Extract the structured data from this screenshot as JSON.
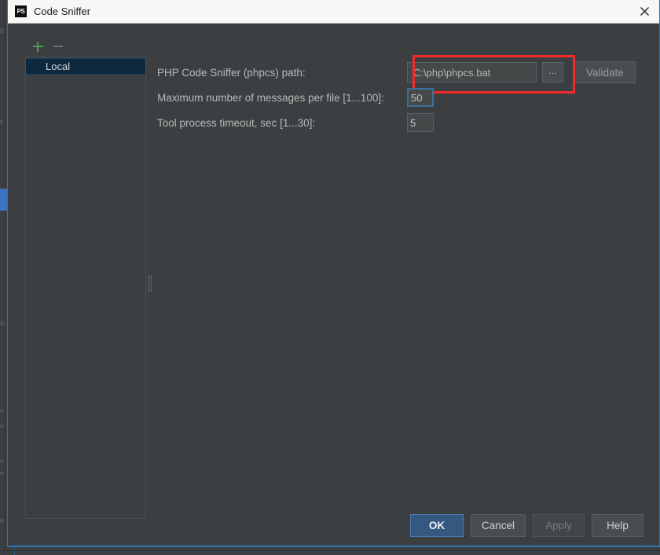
{
  "window": {
    "title": "Code Sniffer",
    "app_icon": "phpstorm-ps-icon",
    "icon_label": "PS",
    "close_icon": "close-icon",
    "accent_color": "#2f75ad",
    "background_color": "#3c3f41"
  },
  "sidebar": {
    "toolbar": {
      "add_icon": "plus-icon",
      "remove_icon": "minus-icon",
      "add_enabled": true,
      "remove_enabled": false
    },
    "items": [
      {
        "label": "Local",
        "selected": true
      }
    ],
    "selection_color": "#0d293f"
  },
  "form": {
    "rows": [
      {
        "label": "PHP Code Sniffer (phpcs) path:",
        "value": "C:\\php\\phpcs.bat",
        "placeholder": "",
        "browse_label": "...",
        "action_label": "Validate",
        "action_enabled": false
      },
      {
        "label": "Maximum number of messages per file [1...100]:",
        "value": "50",
        "focused": true
      },
      {
        "label": "Tool process timeout, sec [1...30]:",
        "value": "5",
        "focused": false
      }
    ]
  },
  "annotation": {
    "color": "#f42a2a",
    "target": "php-code-sniffer-path-field"
  },
  "footer": {
    "buttons": [
      {
        "label": "OK",
        "style": "primary",
        "enabled": true
      },
      {
        "label": "Cancel",
        "style": "normal",
        "enabled": true
      },
      {
        "label": "Apply",
        "style": "disabled",
        "enabled": false
      },
      {
        "label": "Help",
        "style": "normal",
        "enabled": true
      }
    ]
  }
}
